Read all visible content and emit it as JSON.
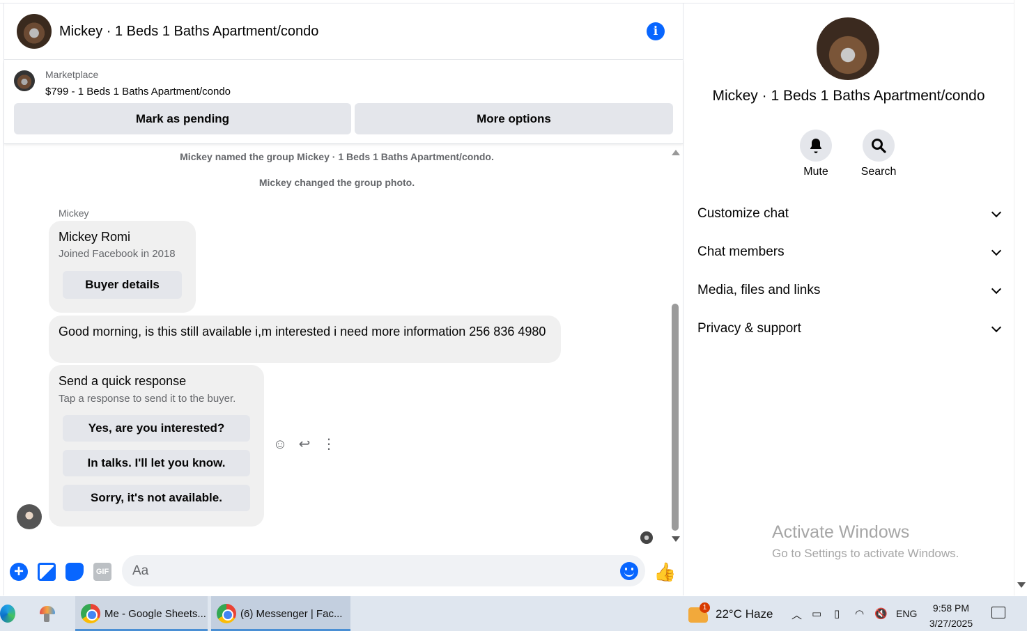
{
  "chat": {
    "title": "Mickey · 1 Beds 1 Baths Apartment/condo",
    "info_icon": "info-icon",
    "marketplace": {
      "label": "Marketplace",
      "listing": "$799 - 1 Beds 1 Baths Apartment/condo",
      "mark_pending": "Mark as pending",
      "more_options": "More options"
    },
    "system_messages": [
      "Mickey named the group Mickey · 1 Beds 1 Baths Apartment/condo.",
      "Mickey changed the group photo."
    ],
    "sender": "Mickey",
    "buyer_card": {
      "name": "Mickey Romi",
      "joined": "Joined Facebook in 2018",
      "button": "Buyer details"
    },
    "message": "Good morning, is this still available i,m interested i need more information 256 836 4980",
    "quick_response": {
      "title": "Send a quick response",
      "subtitle": "Tap a response to send it to the buyer.",
      "options": [
        "Yes, are you interested?",
        "In talks. I'll let you know.",
        "Sorry, it's not available."
      ]
    },
    "composer": {
      "placeholder": "Aa"
    }
  },
  "panel": {
    "title": "Mickey · 1 Beds 1 Baths Apartment/condo",
    "mute_label": "Mute",
    "search_label": "Search",
    "sections": [
      "Customize chat",
      "Chat members",
      "Media, files and links",
      "Privacy & support"
    ]
  },
  "watermark": {
    "title": "Activate Windows",
    "subtitle": "Go to Settings to activate Windows."
  },
  "taskbar": {
    "task1": "Me - Google Sheets...",
    "task2": "(6) Messenger | Fac...",
    "weather_badge": "1",
    "weather": "22°C Haze",
    "lang": "ENG",
    "time": "9:58 PM",
    "date": "3/27/2025"
  },
  "colors": {
    "accent": "#0866ff",
    "bubble": "#f0f0f0",
    "button": "#e4e6eb"
  }
}
